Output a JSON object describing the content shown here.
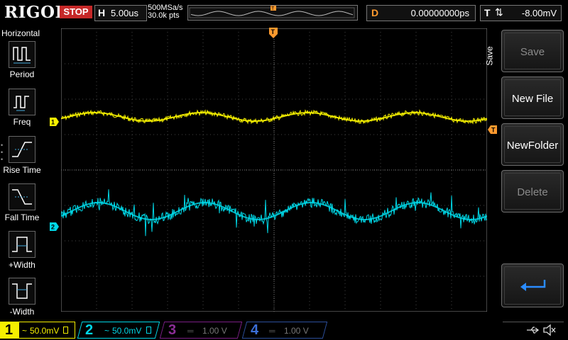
{
  "header": {
    "logo": "RIGOL",
    "status": "STOP",
    "horizontal_key": "H",
    "timebase": "5.00us",
    "sample_rate": "500MSa/s",
    "memory_depth": "30.0k pts",
    "trigger_marker": "T",
    "delay_key": "D",
    "delay_value": "0.00000000ps",
    "trigger_key": "T",
    "trigger_edge": "⇅",
    "trigger_level": "-8.00mV"
  },
  "left_menu": {
    "title": "Horizontal",
    "items": [
      {
        "label": "Period",
        "icon": "period-icon"
      },
      {
        "label": "Freq",
        "icon": "frequency-icon"
      },
      {
        "label": "Rise Time",
        "icon": "rise-time-icon"
      },
      {
        "label": "Fall Time",
        "icon": "fall-time-icon"
      },
      {
        "label": "+Width",
        "icon": "positive-width-icon"
      },
      {
        "label": "-Width",
        "icon": "negative-width-icon"
      }
    ]
  },
  "right_menu": {
    "title": "Save",
    "buttons": [
      {
        "label": "Save",
        "state": "disabled"
      },
      {
        "label": "New File",
        "state": "active"
      },
      {
        "label": "NewFolder",
        "state": "active"
      },
      {
        "label": "Delete",
        "state": "disabled"
      },
      {
        "label": "",
        "icon": "return-arrow-icon",
        "state": "active"
      }
    ]
  },
  "trace_markers": {
    "ch1": "1",
    "ch2": "2",
    "trigger_level": "T",
    "trigger_position": "T"
  },
  "channels": [
    {
      "number": "1",
      "coupling": "~",
      "scale": "50.0mV",
      "color": "#f5f000",
      "active": true
    },
    {
      "number": "2",
      "coupling": "~",
      "scale": "50.0mV",
      "color": "#00d7e6",
      "active": true
    },
    {
      "number": "3",
      "coupling": "",
      "scale": "1.00 V",
      "color": "#c026d3",
      "active": false
    },
    {
      "number": "4",
      "coupling": "",
      "scale": "1.00 V",
      "color": "#3b6fd8",
      "active": false
    }
  ],
  "status_icons": [
    "usb-icon",
    "speaker-muted-icon"
  ],
  "colors": {
    "ch1": "#f5f000",
    "ch2": "#00d7e6",
    "trigger": "#ff9a2e",
    "stop": "#c62828"
  }
}
